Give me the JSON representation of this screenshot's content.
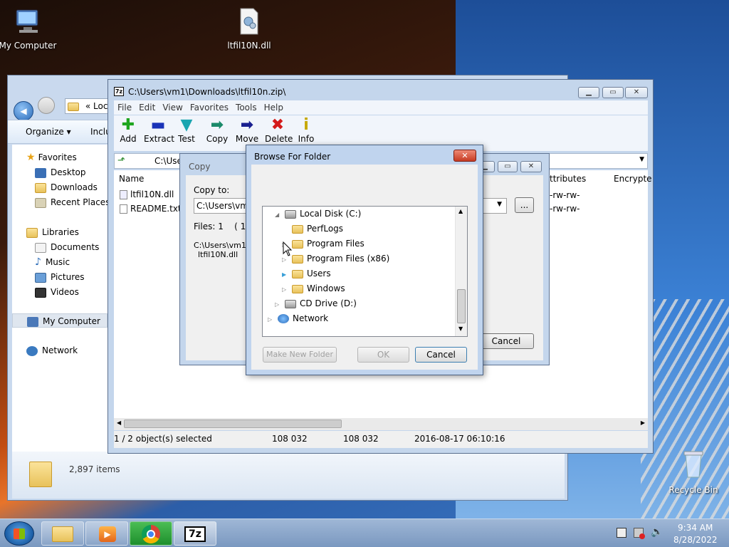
{
  "desktop": {
    "icons": [
      "My Computer",
      "ltfil10N.dll",
      "Recycle Bin"
    ]
  },
  "explorer": {
    "breadcrumb_prefix": "«",
    "breadcrumb_partial": "Loca",
    "organize": "Organize ▾",
    "include_partial": "Inclu",
    "sidebar": {
      "favorites": "Favorites",
      "desktop": "Desktop",
      "downloads": "Downloads",
      "recent": "Recent Places",
      "libraries": "Libraries",
      "documents": "Documents",
      "music": "Music",
      "pictures": "Pictures",
      "videos": "Videos",
      "my_computer": "My Computer",
      "network": "Network"
    },
    "status_items": "2,897 items"
  },
  "zip": {
    "title": "C:\\Users\\vm1\\Downloads\\ltfil10n.zip\\",
    "menu": [
      "File",
      "Edit",
      "View",
      "Favorites",
      "Tools",
      "Help"
    ],
    "toolbar": {
      "add": "Add",
      "extract": "Extract",
      "test": "Test",
      "copy": "Copy",
      "move": "Move",
      "delete": "Delete",
      "info": "Info"
    },
    "address_partial": "C:\\Users",
    "columns": {
      "name": "Name",
      "attributes_partial": "ttributes",
      "encrypted": "Encrypte"
    },
    "files": [
      {
        "name": "ltfil10N.dll",
        "attrs": "-rw-rw-"
      },
      {
        "name": "README.txt",
        "attrs": "-rw-rw-"
      }
    ],
    "status": {
      "selected": "1 / 2 object(s) selected",
      "size": "108 032",
      "packed": "108 032",
      "modified": "2016-08-17 06:10:16"
    }
  },
  "copy_dialog": {
    "title": "Copy",
    "copy_to_label": "Copy to:",
    "path_partial": "C:\\Users\\vm1\\",
    "files_label": "Files: 1    ( 108 0",
    "source_line1": "C:\\Users\\vm1\\",
    "source_line2": "ltfil10N.dll",
    "browse_button": "...",
    "cancel": "Cancel"
  },
  "browse_dialog": {
    "title": "Browse For Folder",
    "tree": {
      "local_disk": "Local Disk (C:)",
      "perflogs": "PerfLogs",
      "program_files": "Program Files",
      "program_files_x86": "Program Files (x86)",
      "users": "Users",
      "windows": "Windows",
      "cd_drive": "CD Drive (D:)",
      "network": "Network"
    },
    "buttons": {
      "make_new_folder": "Make New Folder",
      "ok": "OK",
      "cancel": "Cancel"
    }
  },
  "taskbar": {
    "time": "9:34 AM",
    "date": "8/28/2022",
    "sevenzip_label": "7z"
  }
}
